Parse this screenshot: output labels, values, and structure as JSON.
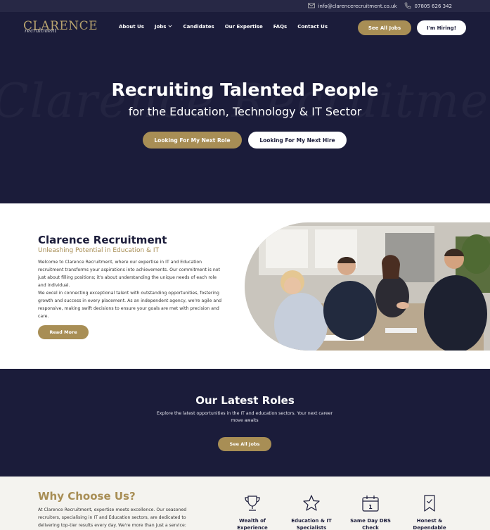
{
  "topbar": {
    "email": "info@clarencerecruitment.co.uk",
    "phone": "07805 626 342"
  },
  "header": {
    "logo_text": "CLARENCE",
    "logo_script": "recruitment",
    "nav": [
      "About Us",
      "Jobs",
      "Candidates",
      "Our Expertise",
      "FAQs",
      "Contact Us"
    ],
    "see_all_jobs": "See All Jobs",
    "hiring": "I'm Hiring!"
  },
  "hero": {
    "watermark": "Clarence Recruitment",
    "title": "Recruiting Talented People",
    "subtitle": "for the Education, Technology & IT Sector",
    "cta_role": "Looking For My Next Role",
    "cta_hire": "Looking For My Next Hire"
  },
  "about": {
    "title": "Clarence Recruitment",
    "subtitle": "Unleashing Potential in Education & IT",
    "para1": "Welcome to Clarence Recruitment, where our expertise in IT and Education recruitment transforms your aspirations into achievements. Our commitment is not just about filling positions; it's about understanding the unique needs of each role and individual.",
    "para2": "We excel in connecting exceptional talent with outstanding opportunities, fostering growth and success in every placement. As an independent agency, we're agile and responsive, making swift decisions to ensure your goals are met with precision and care.",
    "read_more": "Read More"
  },
  "roles": {
    "title": "Our Latest Roles",
    "text": "Explore the latest opportunities in the IT and education sectors. Your next career move awaits",
    "button": "See All Jobs"
  },
  "why": {
    "title": "Why Choose Us?",
    "text": "At Clarence Recruitment, expertise meets excellence. Our seasoned recruiters, specialising in IT and Education sectors, are dedicated to delivering top-tier results every day. We're more than just a service:",
    "features": [
      {
        "label": "Wealth of Experience",
        "icon": "trophy-icon"
      },
      {
        "label": "Education & IT Specialists",
        "icon": "star-icon"
      },
      {
        "label": "Same Day DBS Check",
        "icon": "calendar-icon"
      },
      {
        "label": "Honest & Dependable",
        "icon": "bookmark-check-icon"
      }
    ]
  },
  "colors": {
    "navy": "#1b1c3a",
    "gold": "#a88e55",
    "cream": "#f4f3ef"
  }
}
